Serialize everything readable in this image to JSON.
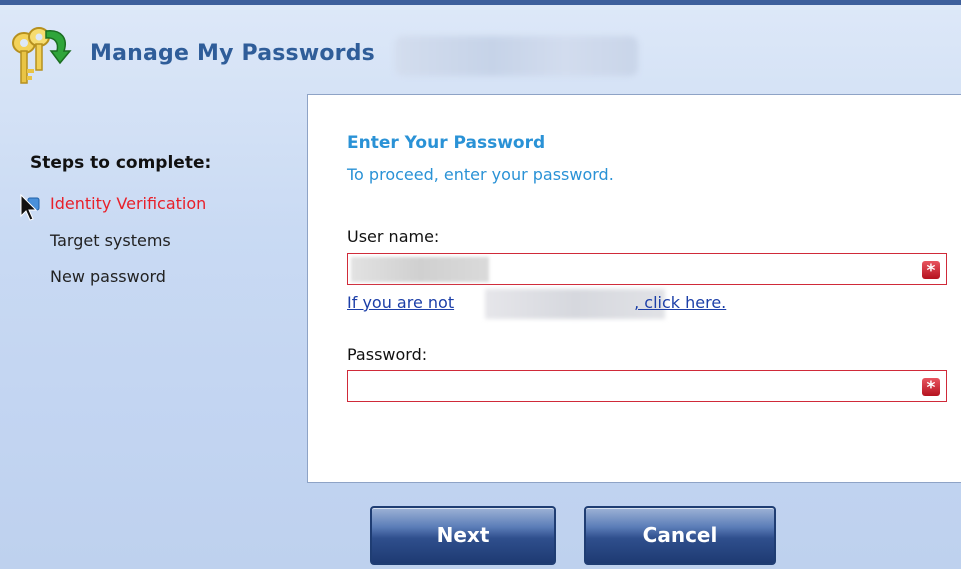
{
  "header": {
    "title": "Manage My Passwords"
  },
  "steps": {
    "title": "Steps to complete:",
    "items": [
      {
        "label": "Identity Verification",
        "active": true
      },
      {
        "label": "Target systems",
        "active": false
      },
      {
        "label": "New password",
        "active": false
      }
    ]
  },
  "form": {
    "title": "Enter Your Password",
    "subtitle": "To proceed, enter your password.",
    "username_label": "User name:",
    "username_value": "",
    "not_you_prefix": "If you are not",
    "not_you_suffix": ", click here.",
    "password_label": "Password:",
    "password_value": "",
    "required_marker": "*"
  },
  "buttons": {
    "next": "Next",
    "cancel": "Cancel"
  },
  "colors": {
    "accent": "#2a92d6",
    "active_step": "#e8202a",
    "field_border": "#d02a39",
    "header_title": "#2f5d99"
  }
}
